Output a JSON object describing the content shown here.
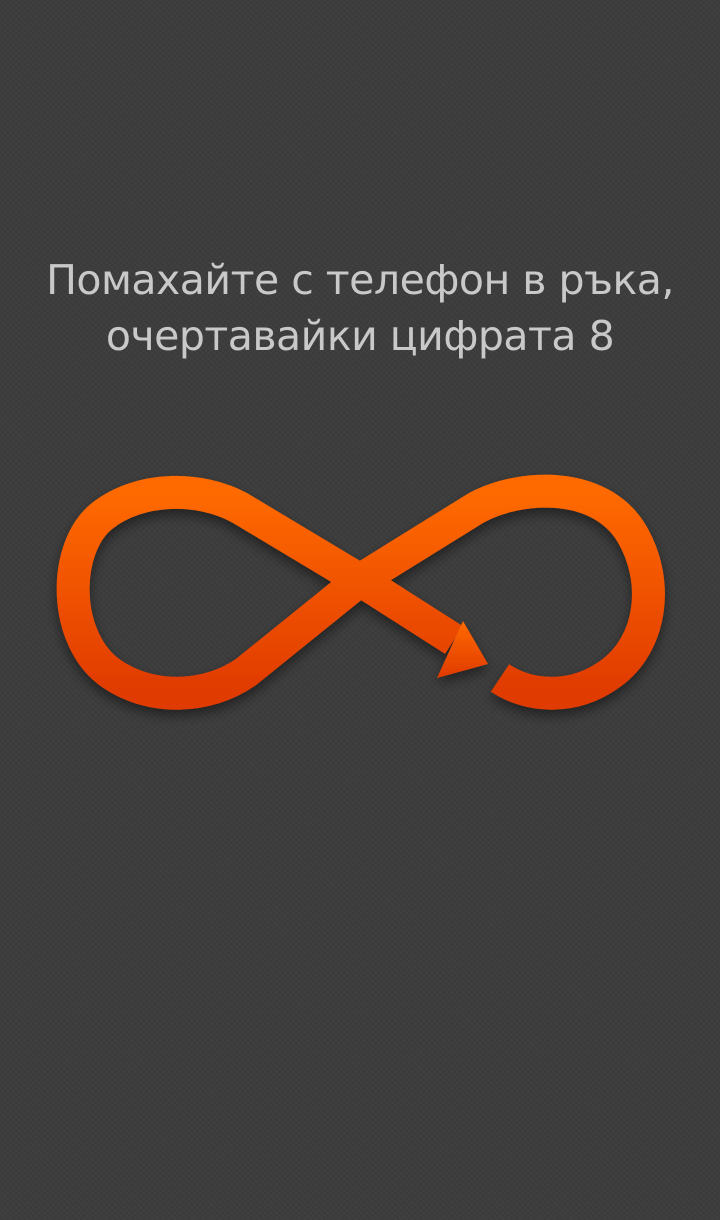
{
  "instruction": {
    "line1": "Помахайте с телефон в ръка,",
    "line2": "очертавайки цифрата 8"
  },
  "gesture": {
    "icon": "figure-eight-arrow-icon",
    "color_top": "#ff6a00",
    "color_bottom": "#e03a00"
  },
  "background_color": "#3d3d3d"
}
